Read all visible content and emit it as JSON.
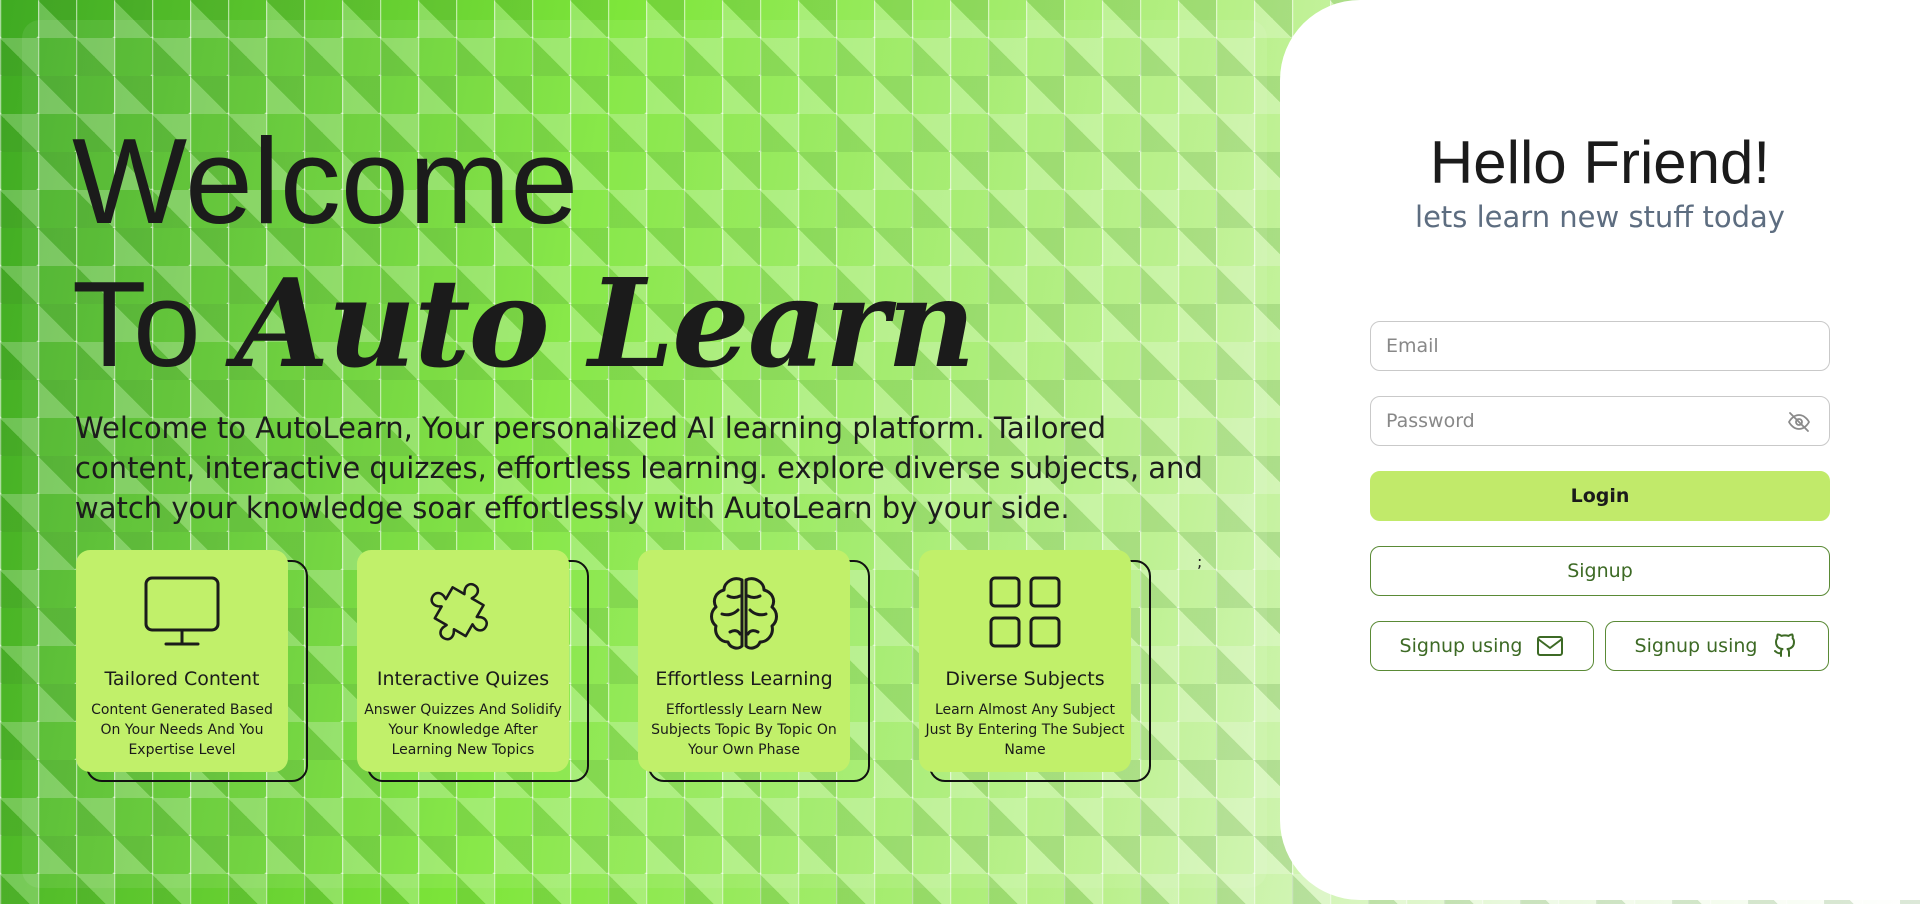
{
  "hero": {
    "title_line1": "Welcome",
    "title_line2_prefix": "To",
    "title_line2_script": "Auto Learn",
    "description": "Welcome to AutoLearn, Your personalized AI learning platform. Tailored content, interactive quizzes, effortless learning. explore diverse subjects, and watch your knowledge soar effortlessly with AutoLearn by your side.",
    "stray_text": ";"
  },
  "features": [
    {
      "icon": "monitor-icon",
      "title": "Tailored Content",
      "desc": "Content Generated Based On Your Needs And You Expertise Level"
    },
    {
      "icon": "puzzle-icon",
      "title": "Interactive Quizes",
      "desc": "Answer Quizzes And Solidify Your Knowledge After Learning New Topics"
    },
    {
      "icon": "brain-icon",
      "title": "Effortless Learning",
      "desc": "Effortlessly Learn New Subjects Topic By Topic On Your Own Phase"
    },
    {
      "icon": "grid-icon",
      "title": "Diverse Subjects",
      "desc": "Learn Almost Any Subject Just By Entering The Subject Name"
    }
  ],
  "login": {
    "greeting": "Hello Friend!",
    "subgreeting": "lets learn new stuff today",
    "email_placeholder": "Email",
    "password_placeholder": "Password",
    "login_label": "Login",
    "signup_label": "Signup",
    "signup_email_label": "Signup using",
    "signup_github_label": "Signup using"
  },
  "colors": {
    "accent": "#c1ea6a",
    "outline_green": "#5a8a36",
    "subtitle": "#5d6d80"
  }
}
